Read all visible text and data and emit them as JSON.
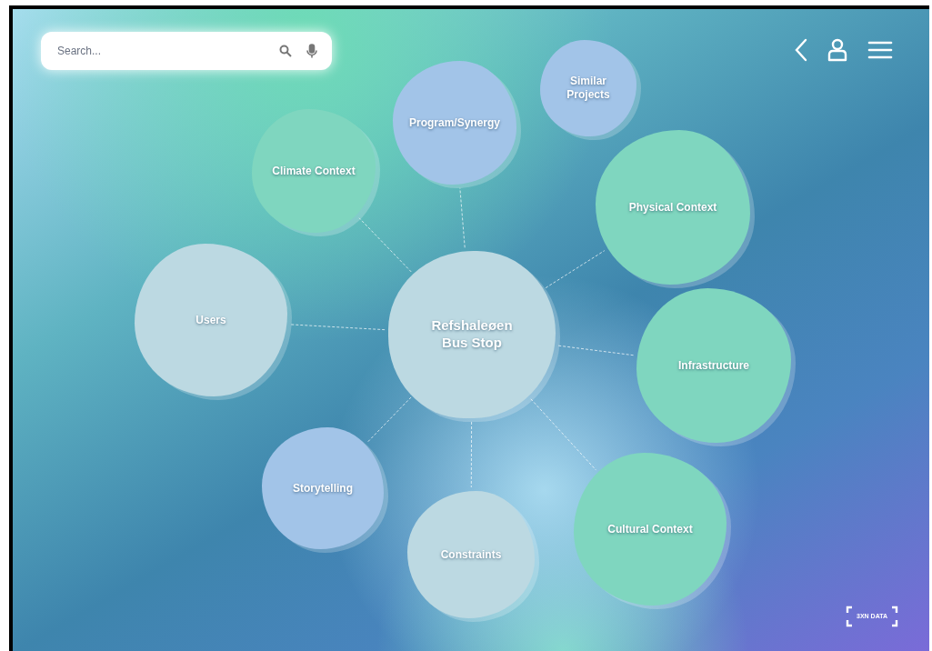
{
  "search": {
    "placeholder": "Search..."
  },
  "mind_map": {
    "nodes": [
      {
        "label": "Similar Projects",
        "kind": "topic",
        "color": "#a2c4e8"
      },
      {
        "label": "Program/Synergy",
        "kind": "topic",
        "color": "#a2c4e8"
      },
      {
        "label": "Climate Context",
        "kind": "topic",
        "color": "#7fd6bf"
      },
      {
        "label": "Physical Context",
        "kind": "topic",
        "color": "#7fd6bf"
      },
      {
        "label": "Users",
        "kind": "topic",
        "color": "#bcd9e2"
      },
      {
        "label": "Refshaleøen Bus Stop",
        "kind": "center",
        "color": "#bcd9e2"
      },
      {
        "label": "Infrastructure",
        "kind": "topic",
        "color": "#7fd6bf"
      },
      {
        "label": "Storytelling",
        "kind": "topic",
        "color": "#a2c4e8"
      },
      {
        "label": "Cultural Context",
        "kind": "topic",
        "color": "#7fd6bf"
      },
      {
        "label": "Constraints",
        "kind": "topic",
        "color": "#bcd9e2"
      }
    ]
  },
  "logo": {
    "text": "3XN DATA"
  }
}
